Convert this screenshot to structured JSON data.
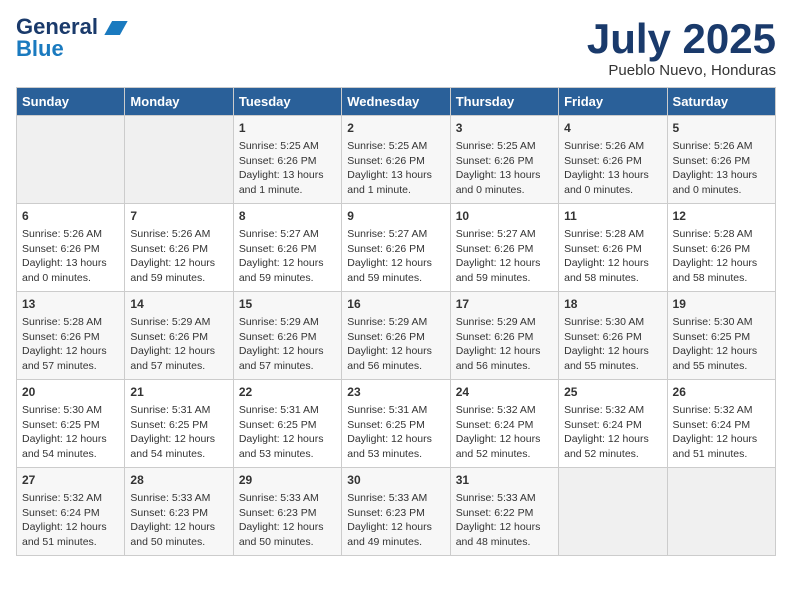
{
  "logo": {
    "line1": "General",
    "line2": "Blue"
  },
  "title": "July 2025",
  "subtitle": "Pueblo Nuevo, Honduras",
  "days_of_week": [
    "Sunday",
    "Monday",
    "Tuesday",
    "Wednesday",
    "Thursday",
    "Friday",
    "Saturday"
  ],
  "weeks": [
    [
      {
        "day": "",
        "sunrise": "",
        "sunset": "",
        "daylight": ""
      },
      {
        "day": "",
        "sunrise": "",
        "sunset": "",
        "daylight": ""
      },
      {
        "day": "1",
        "sunrise": "Sunrise: 5:25 AM",
        "sunset": "Sunset: 6:26 PM",
        "daylight": "Daylight: 13 hours and 1 minute."
      },
      {
        "day": "2",
        "sunrise": "Sunrise: 5:25 AM",
        "sunset": "Sunset: 6:26 PM",
        "daylight": "Daylight: 13 hours and 1 minute."
      },
      {
        "day": "3",
        "sunrise": "Sunrise: 5:25 AM",
        "sunset": "Sunset: 6:26 PM",
        "daylight": "Daylight: 13 hours and 0 minutes."
      },
      {
        "day": "4",
        "sunrise": "Sunrise: 5:26 AM",
        "sunset": "Sunset: 6:26 PM",
        "daylight": "Daylight: 13 hours and 0 minutes."
      },
      {
        "day": "5",
        "sunrise": "Sunrise: 5:26 AM",
        "sunset": "Sunset: 6:26 PM",
        "daylight": "Daylight: 13 hours and 0 minutes."
      }
    ],
    [
      {
        "day": "6",
        "sunrise": "Sunrise: 5:26 AM",
        "sunset": "Sunset: 6:26 PM",
        "daylight": "Daylight: 13 hours and 0 minutes."
      },
      {
        "day": "7",
        "sunrise": "Sunrise: 5:26 AM",
        "sunset": "Sunset: 6:26 PM",
        "daylight": "Daylight: 12 hours and 59 minutes."
      },
      {
        "day": "8",
        "sunrise": "Sunrise: 5:27 AM",
        "sunset": "Sunset: 6:26 PM",
        "daylight": "Daylight: 12 hours and 59 minutes."
      },
      {
        "day": "9",
        "sunrise": "Sunrise: 5:27 AM",
        "sunset": "Sunset: 6:26 PM",
        "daylight": "Daylight: 12 hours and 59 minutes."
      },
      {
        "day": "10",
        "sunrise": "Sunrise: 5:27 AM",
        "sunset": "Sunset: 6:26 PM",
        "daylight": "Daylight: 12 hours and 59 minutes."
      },
      {
        "day": "11",
        "sunrise": "Sunrise: 5:28 AM",
        "sunset": "Sunset: 6:26 PM",
        "daylight": "Daylight: 12 hours and 58 minutes."
      },
      {
        "day": "12",
        "sunrise": "Sunrise: 5:28 AM",
        "sunset": "Sunset: 6:26 PM",
        "daylight": "Daylight: 12 hours and 58 minutes."
      }
    ],
    [
      {
        "day": "13",
        "sunrise": "Sunrise: 5:28 AM",
        "sunset": "Sunset: 6:26 PM",
        "daylight": "Daylight: 12 hours and 57 minutes."
      },
      {
        "day": "14",
        "sunrise": "Sunrise: 5:29 AM",
        "sunset": "Sunset: 6:26 PM",
        "daylight": "Daylight: 12 hours and 57 minutes."
      },
      {
        "day": "15",
        "sunrise": "Sunrise: 5:29 AM",
        "sunset": "Sunset: 6:26 PM",
        "daylight": "Daylight: 12 hours and 57 minutes."
      },
      {
        "day": "16",
        "sunrise": "Sunrise: 5:29 AM",
        "sunset": "Sunset: 6:26 PM",
        "daylight": "Daylight: 12 hours and 56 minutes."
      },
      {
        "day": "17",
        "sunrise": "Sunrise: 5:29 AM",
        "sunset": "Sunset: 6:26 PM",
        "daylight": "Daylight: 12 hours and 56 minutes."
      },
      {
        "day": "18",
        "sunrise": "Sunrise: 5:30 AM",
        "sunset": "Sunset: 6:26 PM",
        "daylight": "Daylight: 12 hours and 55 minutes."
      },
      {
        "day": "19",
        "sunrise": "Sunrise: 5:30 AM",
        "sunset": "Sunset: 6:25 PM",
        "daylight": "Daylight: 12 hours and 55 minutes."
      }
    ],
    [
      {
        "day": "20",
        "sunrise": "Sunrise: 5:30 AM",
        "sunset": "Sunset: 6:25 PM",
        "daylight": "Daylight: 12 hours and 54 minutes."
      },
      {
        "day": "21",
        "sunrise": "Sunrise: 5:31 AM",
        "sunset": "Sunset: 6:25 PM",
        "daylight": "Daylight: 12 hours and 54 minutes."
      },
      {
        "day": "22",
        "sunrise": "Sunrise: 5:31 AM",
        "sunset": "Sunset: 6:25 PM",
        "daylight": "Daylight: 12 hours and 53 minutes."
      },
      {
        "day": "23",
        "sunrise": "Sunrise: 5:31 AM",
        "sunset": "Sunset: 6:25 PM",
        "daylight": "Daylight: 12 hours and 53 minutes."
      },
      {
        "day": "24",
        "sunrise": "Sunrise: 5:32 AM",
        "sunset": "Sunset: 6:24 PM",
        "daylight": "Daylight: 12 hours and 52 minutes."
      },
      {
        "day": "25",
        "sunrise": "Sunrise: 5:32 AM",
        "sunset": "Sunset: 6:24 PM",
        "daylight": "Daylight: 12 hours and 52 minutes."
      },
      {
        "day": "26",
        "sunrise": "Sunrise: 5:32 AM",
        "sunset": "Sunset: 6:24 PM",
        "daylight": "Daylight: 12 hours and 51 minutes."
      }
    ],
    [
      {
        "day": "27",
        "sunrise": "Sunrise: 5:32 AM",
        "sunset": "Sunset: 6:24 PM",
        "daylight": "Daylight: 12 hours and 51 minutes."
      },
      {
        "day": "28",
        "sunrise": "Sunrise: 5:33 AM",
        "sunset": "Sunset: 6:23 PM",
        "daylight": "Daylight: 12 hours and 50 minutes."
      },
      {
        "day": "29",
        "sunrise": "Sunrise: 5:33 AM",
        "sunset": "Sunset: 6:23 PM",
        "daylight": "Daylight: 12 hours and 50 minutes."
      },
      {
        "day": "30",
        "sunrise": "Sunrise: 5:33 AM",
        "sunset": "Sunset: 6:23 PM",
        "daylight": "Daylight: 12 hours and 49 minutes."
      },
      {
        "day": "31",
        "sunrise": "Sunrise: 5:33 AM",
        "sunset": "Sunset: 6:22 PM",
        "daylight": "Daylight: 12 hours and 48 minutes."
      },
      {
        "day": "",
        "sunrise": "",
        "sunset": "",
        "daylight": ""
      },
      {
        "day": "",
        "sunrise": "",
        "sunset": "",
        "daylight": ""
      }
    ]
  ]
}
